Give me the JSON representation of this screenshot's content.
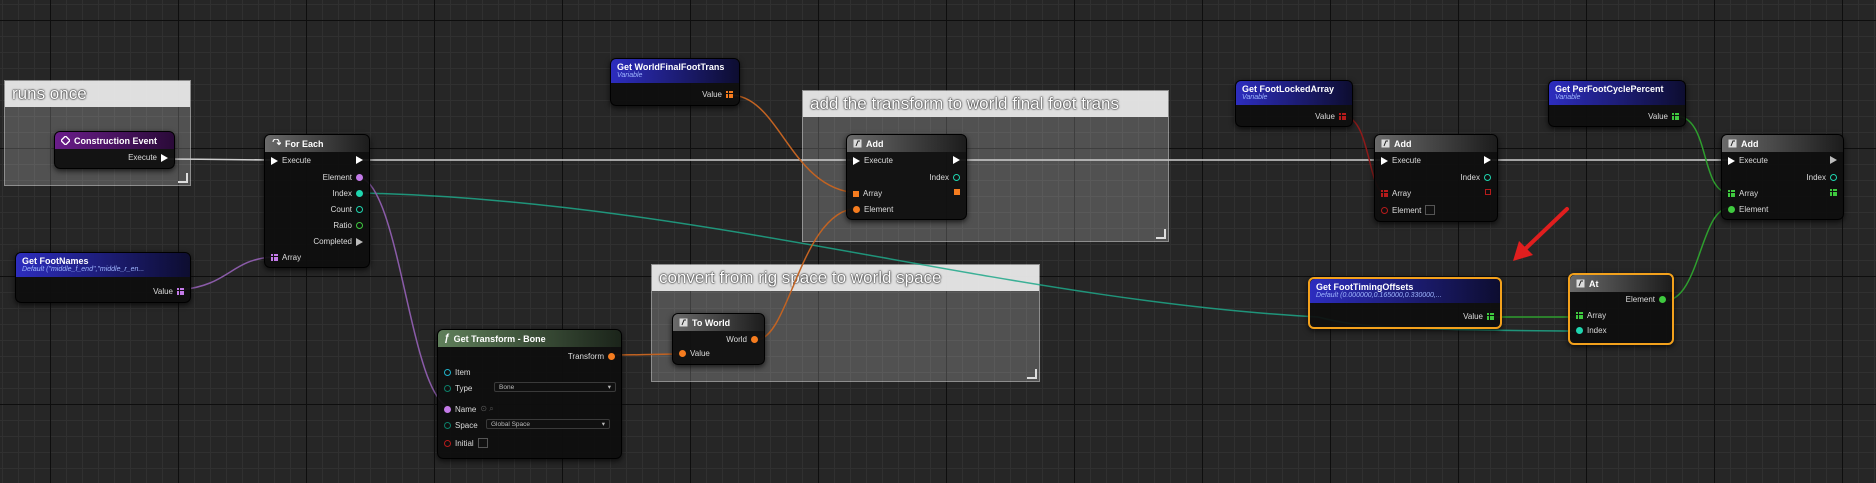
{
  "comments": {
    "runs_once": "runs once",
    "add_transform": "add the transform to world final foot trans",
    "convert": "convert from rig space to world space"
  },
  "construction_event": {
    "title": "Construction Event",
    "execute": "Execute"
  },
  "for_each": {
    "title": "For Each",
    "execute": "Execute",
    "element": "Element",
    "index": "Index",
    "count": "Count",
    "ratio": "Ratio",
    "completed": "Completed",
    "array": "Array"
  },
  "get_foot_names": {
    "title": "Get FootNames",
    "subtitle": "Default (\"middle_f_end\",\"middle_r_en...",
    "value": "Value"
  },
  "get_world_final": {
    "title": "Get WorldFinalFootTrans",
    "subtitle": "Variable",
    "value": "Value"
  },
  "add_node_1": {
    "title": "Add",
    "execute": "Execute",
    "index": "Index",
    "array": "Array",
    "element": "Element"
  },
  "get_transform_bone": {
    "title": "Get Transform - Bone",
    "transform": "Transform",
    "item": "Item",
    "type": "Type",
    "type_value": "Bone",
    "name": "Name",
    "space": "Space",
    "space_value": "Global Space",
    "initial": "Initial"
  },
  "to_world": {
    "title": "To World",
    "world": "World",
    "value": "Value"
  },
  "get_foot_locked": {
    "title": "Get FootLockedArray",
    "subtitle": "Variable",
    "value": "Value"
  },
  "add_node_2": {
    "title": "Add",
    "execute": "Execute",
    "index": "Index",
    "array": "Array",
    "element": "Element"
  },
  "get_foot_timing": {
    "title": "Get FootTimingOffsets",
    "subtitle": "Default (0.000000,0.165000,0.330000,...",
    "value": "Value"
  },
  "get_per_foot": {
    "title": "Get PerFootCyclePercent",
    "subtitle": "Variable",
    "value": "Value"
  },
  "add_node_3": {
    "title": "Add",
    "execute": "Execute",
    "index": "Index",
    "array": "Array",
    "element": "Element"
  },
  "at_node": {
    "title": "At",
    "element": "Element",
    "array": "Array",
    "index": "Index"
  },
  "colors": {
    "exec": "#ffffff",
    "transform": "#f57c1f",
    "int": "#1fd6b0",
    "name": "#c37ae8",
    "float": "#3fc93f",
    "bool": "#b51b1b",
    "selection": "#f3a11c",
    "annotation_arrow": "#e01e1e"
  },
  "icons": {
    "construction_event": "event-diamond-icon",
    "for_each": "loop-icon",
    "add": "function-f-icon",
    "get_transform": "function-f-icon",
    "to_world": "function-f-icon",
    "at": "function-f-icon"
  }
}
